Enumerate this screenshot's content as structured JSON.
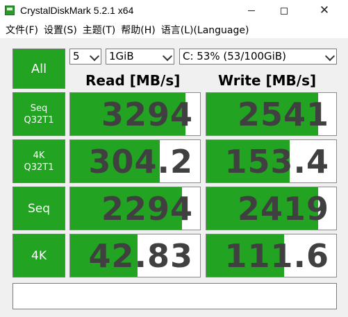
{
  "window": {
    "title": "CrystalDiskMark 5.2.1 x64"
  },
  "menu": [
    {
      "label": "文件(F)"
    },
    {
      "label": "设置(S)"
    },
    {
      "label": "主题(T)"
    },
    {
      "label": "帮助(H)"
    },
    {
      "label": "语言(L)(Language)"
    }
  ],
  "controls": {
    "all_button": "All",
    "test_count": "5",
    "test_size": "1GiB",
    "drive": "C: 53% (53/100GiB)"
  },
  "headers": {
    "read": "Read [MB/s]",
    "write": "Write [MB/s]"
  },
  "tests": [
    {
      "label_line1": "Seq",
      "label_line2": "Q32T1",
      "read": "3294",
      "write": "2541",
      "read_fill": 0.89,
      "write_fill": 0.86
    },
    {
      "label_line1": "4K",
      "label_line2": "Q32T1",
      "read": "304.2",
      "write": "153.4",
      "read_fill": 0.69,
      "write_fill": 0.64
    },
    {
      "label_line1": "Seq",
      "label_line2": "",
      "read": "2294",
      "write": "2419",
      "read_fill": 0.86,
      "write_fill": 0.86
    },
    {
      "label_line1": "4K",
      "label_line2": "",
      "read": "42.83",
      "write": "111.6",
      "read_fill": 0.52,
      "write_fill": 0.6
    }
  ],
  "colors": {
    "accent_green": "#22a322",
    "value_text": "#404040"
  }
}
